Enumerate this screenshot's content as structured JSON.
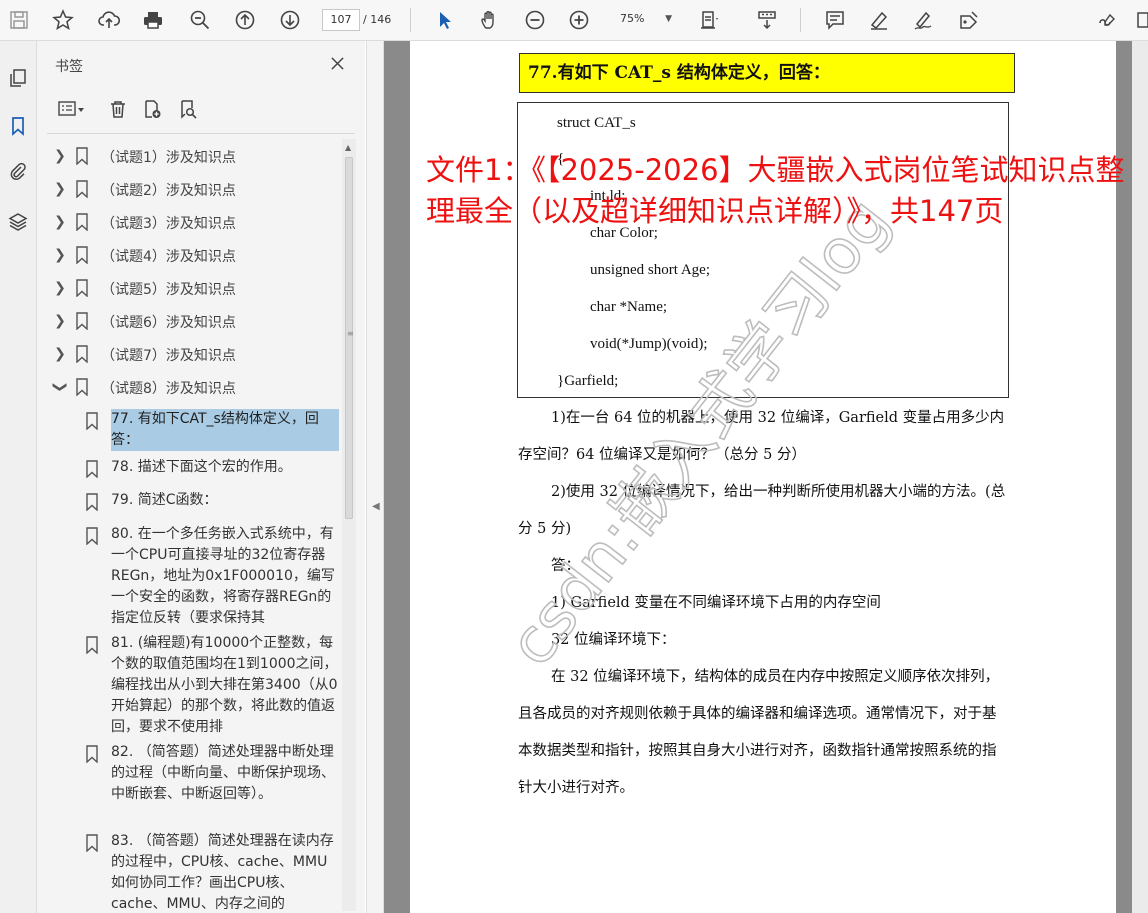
{
  "toolbar": {
    "page_current": "107",
    "page_total": "/ 146",
    "zoom": "75%"
  },
  "panel": {
    "title": "书签",
    "top_items": [
      {
        "label": "（试题1）涉及知识点"
      },
      {
        "label": "（试题2）涉及知识点"
      },
      {
        "label": "（试题3）涉及知识点"
      },
      {
        "label": "（试题4）涉及知识点"
      },
      {
        "label": "（试题5）涉及知识点"
      },
      {
        "label": "（试题6）涉及知识点"
      },
      {
        "label": "（试题7）涉及知识点"
      },
      {
        "label": "（试题8）涉及知识点"
      }
    ],
    "children": [
      {
        "label": "77. 有如下CAT_s结构体定义，回答："
      },
      {
        "label": "78. 描述下面这个宏的作用。"
      },
      {
        "label": "79. 简述C函数："
      },
      {
        "label": "80. 在一个多任务嵌入式系统中，有一个CPU可直接寻址的32位寄存器REGn，地址为0x1F000010，编写一个安全的函数，将寄存器REGn的指定位反转（要求保持其"
      },
      {
        "label": "81. (编程题)有10000个正整数，每个数的取值范围均在1到1000之间，编程找出从小到大排在第3400（从0开始算起）的那个数，将此数的值返回，要求不使用排"
      },
      {
        "label": "82. （简答题）简述处理器中断处理的过程（中断向量、中断保护现场、中断嵌套、中断返回等）。"
      },
      {
        "label": "83. （简答题）简述处理器在读内存的过程中，CPU核、cache、MMU如何协同工作？画出CPU核、cache、MMU、内存之间的"
      }
    ]
  },
  "document": {
    "question_heading": "77.有如下 CAT_s 结构体定义，回答：",
    "code_lines": [
      "struct CAT_s",
      "{",
      "int ld;",
      "char Color;",
      "unsigned short Age;",
      "char *Name;",
      "void(*Jump)(void);",
      "}Garfield;"
    ],
    "para1": "1)在一台 64 位的机器上，使用 32 位编译，Garfield 变量占用多少内存空间？64 位编译又是如何？（总分 5 分）",
    "para2": "2)使用 32 位编译情况下，给出一种判断所使用机器大小端的方法。(总分 5 分)",
    "answer_label": "答：",
    "answer_1": "1) Garfield 变量在不同编译环境下占用的内存空间",
    "answer_2": "32 位编译环境下：",
    "answer_3": "在 32 位编译环境下，结构体的成员在内存中按照定义顺序依次排列，且各成员的对齐规则依赖于具体的编译器和编译选项。通常情况下，对于基本数据类型和指针，按照其自身大小进行对齐，函数指针通常按照系统的指针大小进行对齐。",
    "overlay_text": "文件1：《【2025-2026】大疆嵌入式岗位笔试知识点整理最全（以及超详细知识点详解）》，共147页",
    "watermark": "csdn:嵌入式学习log"
  },
  "colors": {
    "heading_bg": "#ffff00",
    "overlay_red": "#ee1111",
    "selected_bg": "#a9cbe4"
  }
}
